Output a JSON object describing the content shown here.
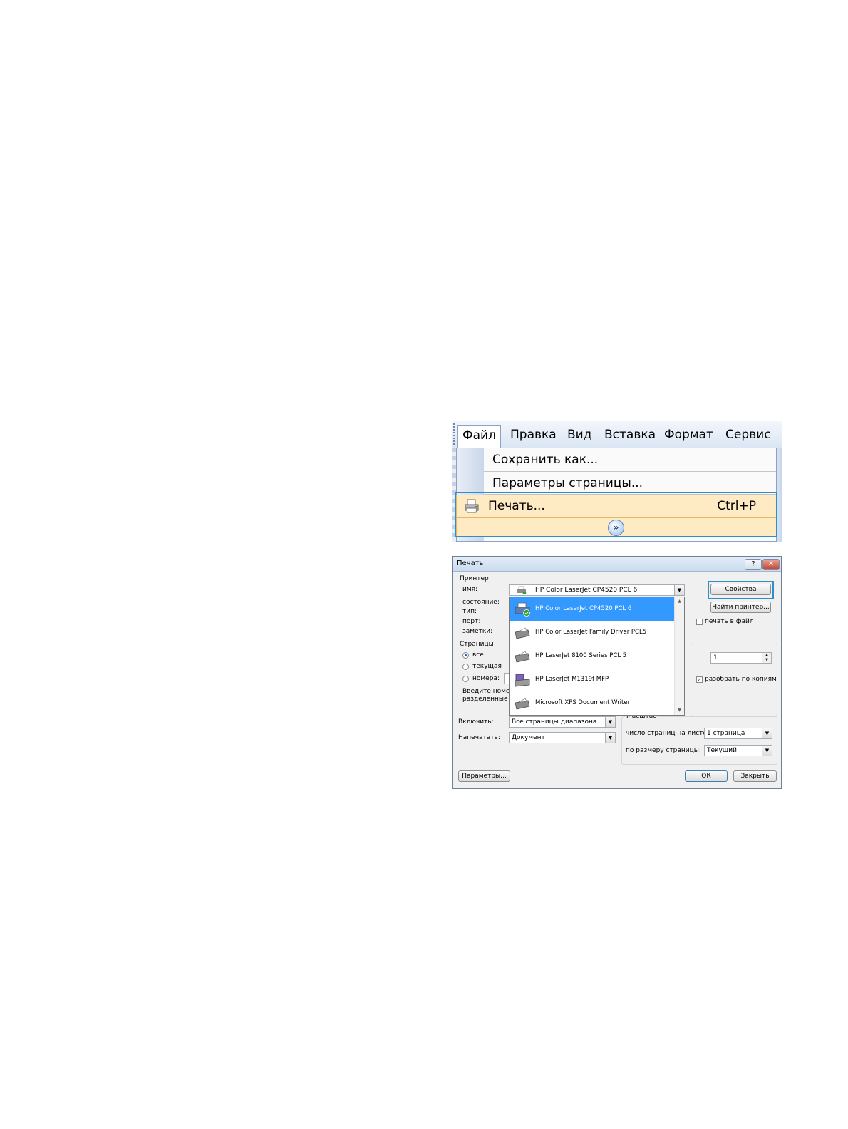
{
  "menu": {
    "bar_items": [
      "Файл",
      "Правка",
      "Вид",
      "Вставка",
      "Формат",
      "Сервис"
    ],
    "dropdown": {
      "save_as": "Сохранить как...",
      "page_setup": "Параметры страницы...",
      "print": "Печать...",
      "print_shortcut": "Ctrl+P"
    }
  },
  "dialog": {
    "title": "Печать",
    "help_glyph": "?",
    "close_glyph": "✕",
    "printer_group": "Принтер",
    "name_label": "имя:",
    "status_label": "состояние:",
    "type_label": "тип:",
    "port_label": "порт:",
    "notes_label": "заметки:",
    "printer_selected": "HP Color LaserJet CP4520 PCL 6",
    "properties_button": "Свойства",
    "find_printer_button": "Найти принтер...",
    "print_to_file": "печать в файл",
    "print_to_file_checked": false,
    "printer_list": [
      {
        "name": "HP Color LaserJet CP4520 PCL 6",
        "selected": true
      },
      {
        "name": "HP Color LaserJet Family Driver PCL5",
        "selected": false
      },
      {
        "name": "HP LaserJet 8100 Series PCL 5",
        "selected": false
      },
      {
        "name": "HP LaserJet M1319f MFP",
        "selected": false
      },
      {
        "name": "Microsoft XPS Document Writer",
        "selected": false
      }
    ],
    "pages_group": "Страницы",
    "range_all": "все",
    "range_current": "текущая",
    "range_pages": "номера:",
    "range_hint_1": "Введите номер",
    "range_hint_2": "разделенные з",
    "copies_value": "1",
    "collate": "разобрать по копиям",
    "collate_checked": true,
    "include_label": "Включить:",
    "include_value": "Все страницы диапазона",
    "print_what_label": "Напечатать:",
    "print_what_value": "Документ",
    "zoom_group": "Масштаб",
    "pages_per_sheet_label": "число страниц на листе:",
    "pages_per_sheet_value": "1 страница",
    "scale_to_paper_label": "по размеру страницы:",
    "scale_to_paper_value": "Текущий",
    "options_button": "Параметры...",
    "ok_button": "ОК",
    "close_button": "Закрыть"
  },
  "colors": {
    "highlight_border": "#2f8ec7",
    "menu_hover_fill": "#feebc3",
    "list_selection": "#3399ff"
  }
}
